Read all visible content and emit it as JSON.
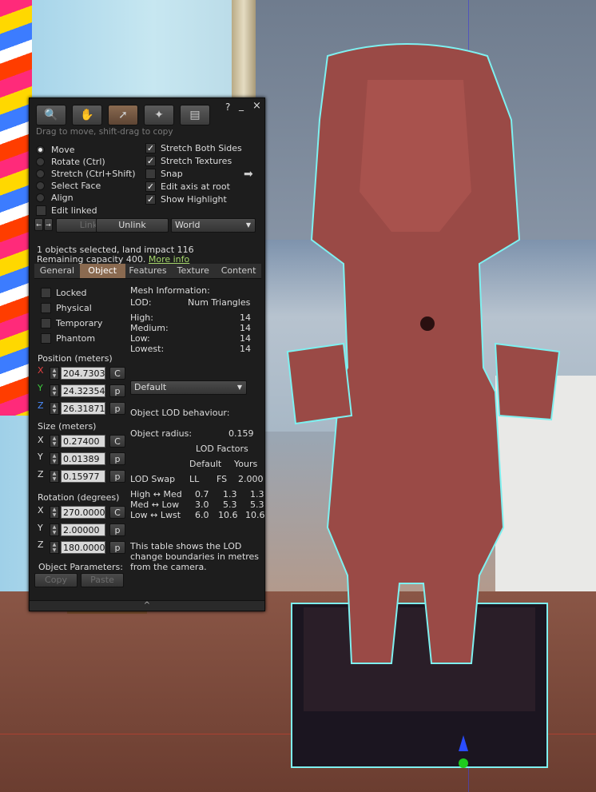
{
  "toolbar": {
    "help": "?",
    "minimize": "_",
    "close": "×",
    "hint": "Drag to move, shift-drag to copy",
    "tools": [
      "focus-tool-icon",
      "move-tool-icon",
      "edit-tool-icon",
      "create-tool-icon",
      "land-tool-icon"
    ]
  },
  "modes": {
    "move": "Move",
    "rotate": "Rotate (Ctrl)",
    "stretch": "Stretch (Ctrl+Shift)",
    "select_face": "Select Face",
    "align": "Align",
    "edit_linked": "Edit linked"
  },
  "options": {
    "stretch_both": "Stretch Both Sides",
    "stretch_textures": "Stretch Textures",
    "snap": "Snap",
    "edit_axis": "Edit axis at root",
    "show_highlight": "Show Highlight"
  },
  "link_row": {
    "link": "Link",
    "unlink": "Unlink",
    "ruler": "World"
  },
  "selection": {
    "line1": "1 objects selected, land impact 116",
    "line2": "Remaining capacity 400.",
    "more_info": "More info"
  },
  "tabs": [
    "General",
    "Object",
    "Features",
    "Texture",
    "Content"
  ],
  "object": {
    "locked": "Locked",
    "physical": "Physical",
    "temporary": "Temporary",
    "phantom": "Phantom",
    "position_label": "Position (meters)",
    "size_label": "Size (meters)",
    "rotation_label": "Rotation (degrees)",
    "x": "X",
    "y": "Y",
    "z": "Z",
    "c": "C",
    "p": "p",
    "position": [
      "204.73033",
      "24.32354",
      "26.31871"
    ],
    "size": [
      "0.27400",
      "0.01389",
      "0.15977"
    ],
    "rotation": [
      "270.00000",
      "2.00000",
      "180.00000"
    ],
    "params_label": "Object Parameters:",
    "copy": "Copy",
    "paste": "Paste"
  },
  "mesh": {
    "heading": "Mesh Information:",
    "lod": "LOD:",
    "num_tri": "Num Triangles",
    "rows": [
      {
        "label": "High:",
        "value": "14"
      },
      {
        "label": "Medium:",
        "value": "14"
      },
      {
        "label": "Low:",
        "value": "14"
      },
      {
        "label": "Lowest:",
        "value": "14"
      }
    ],
    "dropdown": "Default",
    "lod_behaviour": "Object LOD behaviour:",
    "radius_label": "Object radius:",
    "radius_value": "0.159",
    "factors": "LOD Factors",
    "default": "Default",
    "yours": "Yours",
    "swap": "LOD Swap",
    "ll": "LL",
    "fs": "FS",
    "yours_value": "2.000",
    "swap_rows": [
      {
        "label": "High ↔ Med",
        "ll": "0.7",
        "fs": "1.3",
        "yours": "1.3"
      },
      {
        "label": "Med ↔ Low",
        "ll": "3.0",
        "fs": "5.3",
        "yours": "5.3"
      },
      {
        "label": "Low ↔ Lwst",
        "ll": "6.0",
        "fs": "10.6",
        "yours": "10.6"
      }
    ],
    "note": [
      "This table shows the LOD",
      "change boundaries in metres",
      "from the camera."
    ]
  },
  "footer": {
    "expand": "^"
  }
}
